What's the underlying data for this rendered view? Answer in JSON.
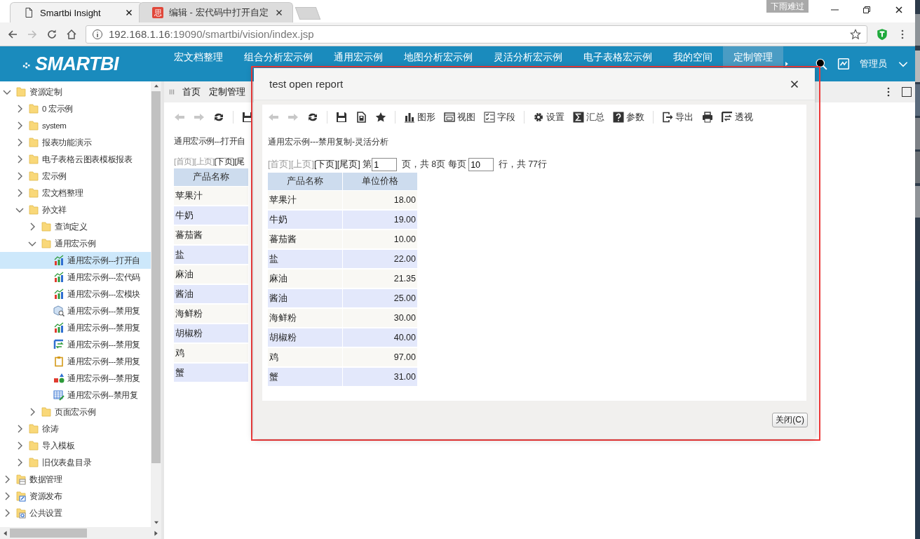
{
  "browser": {
    "tabs": [
      {
        "title": "Smartbi Insight",
        "selected": true
      },
      {
        "favicon_text": "思",
        "title": "编辑 - 宏代码中打开自定",
        "selected": false
      }
    ],
    "overlay_label": "下雨难过",
    "url_host": "192.168.1.16",
    "url_path": ":19090/smartbi/vision/index.jsp"
  },
  "header": {
    "logo": "SMARTBI",
    "nav": [
      {
        "label": "宏文档整理",
        "selected": false
      },
      {
        "label": "组合分析宏示例",
        "selected": false
      },
      {
        "label": "通用宏示例",
        "selected": false
      },
      {
        "label": "地图分析宏示例",
        "selected": false
      },
      {
        "label": "灵活分析宏示例",
        "selected": false
      },
      {
        "label": "电子表格宏示例",
        "selected": false
      },
      {
        "label": "我的空间",
        "selected": false
      },
      {
        "label": "定制管理",
        "selected": true
      }
    ],
    "user": "管理员"
  },
  "tree": [
    {
      "label": "资源定制",
      "kind": "folder",
      "expanded": true,
      "selected": false,
      "children": [
        {
          "label": "0 宏示例",
          "kind": "folder",
          "expanded": false,
          "selected": false
        },
        {
          "label": "system",
          "kind": "folder",
          "expanded": false,
          "selected": false
        },
        {
          "label": "报表功能演示",
          "kind": "folder",
          "expanded": false,
          "selected": false
        },
        {
          "label": "电子表格云图表模板报表",
          "kind": "folder",
          "expanded": false,
          "selected": false
        },
        {
          "label": "宏示例",
          "kind": "folder",
          "expanded": false,
          "selected": false
        },
        {
          "label": "宏文档整理",
          "kind": "folder",
          "expanded": false,
          "selected": false
        },
        {
          "label": "孙文祥",
          "kind": "folder",
          "expanded": true,
          "selected": false,
          "children": [
            {
              "label": "查询定义",
              "kind": "folder",
              "expanded": false,
              "selected": false
            },
            {
              "label": "通用宏示例",
              "kind": "folder",
              "expanded": true,
              "selected": false,
              "children": [
                {
                  "label": "通用宏示例---打开自",
                  "kind": "chart",
                  "selected": true
                },
                {
                  "label": "通用宏示例---宏代码",
                  "kind": "chart",
                  "selected": false
                },
                {
                  "label": "通用宏示例---宏模块",
                  "kind": "chart",
                  "selected": false
                },
                {
                  "label": "通用宏示例---禁用复",
                  "kind": "cube",
                  "selected": false
                },
                {
                  "label": "通用宏示例---禁用复",
                  "kind": "chart",
                  "selected": false
                },
                {
                  "label": "通用宏示例---禁用复",
                  "kind": "flow",
                  "selected": false
                },
                {
                  "label": "通用宏示例---禁用复",
                  "kind": "clipboard",
                  "selected": false
                },
                {
                  "label": "通用宏示例---禁用复",
                  "kind": "shapes",
                  "selected": false
                },
                {
                  "label": "通用宏示例--禁用复",
                  "kind": "grid",
                  "selected": false
                }
              ]
            },
            {
              "label": "页面宏示例",
              "kind": "folder",
              "expanded": false,
              "selected": false
            }
          ]
        },
        {
          "label": "徐涛",
          "kind": "folder",
          "expanded": false,
          "selected": false
        },
        {
          "label": "导入模板",
          "kind": "folder",
          "expanded": false,
          "selected": false
        },
        {
          "label": "旧仪表盘目录",
          "kind": "folder",
          "expanded": false,
          "selected": false
        }
      ]
    },
    {
      "label": "数据管理",
      "kind": "data",
      "expanded": false,
      "selected": false
    },
    {
      "label": "资源发布",
      "kind": "publish",
      "expanded": false,
      "selected": false
    },
    {
      "label": "公共设置",
      "kind": "settings",
      "expanded": false,
      "selected": false
    }
  ],
  "workspace": {
    "tabs": [
      "首页",
      "定制管理"
    ],
    "toolbar": [
      {
        "disabled": true
      },
      {
        "disabled": true
      },
      {
        "disabled": false
      },
      {
        "disabled": false
      }
    ],
    "report_title": "通用宏示例---打开自",
    "pager": [
      {
        "label": "[首页]",
        "disabled": true
      },
      {
        "label": "[上页]",
        "disabled": true
      },
      {
        "label": "[下页]",
        "disabled": false
      },
      {
        "label": "[尾",
        "disabled": false
      }
    ],
    "table": {
      "columns": [
        "产品名称"
      ],
      "rows": [
        [
          "苹果汁"
        ],
        [
          "牛奶"
        ],
        [
          "蕃茄酱"
        ],
        [
          "盐"
        ],
        [
          "麻油"
        ],
        [
          "酱油"
        ],
        [
          "海鲜粉"
        ],
        [
          "胡椒粉"
        ],
        [
          "鸡"
        ],
        [
          "蟹"
        ]
      ]
    }
  },
  "dialog": {
    "title": "test open report",
    "toolbar": [
      [
        {
          "disabled": true
        },
        {
          "disabled": true
        },
        {
          "disabled": false
        }
      ],
      [
        {
          "disabled": false
        },
        {
          "disabled": false
        },
        {
          "disabled": false
        }
      ],
      [
        {
          "label": "图形",
          "disabled": false
        },
        {
          "label": "视图",
          "disabled": false
        },
        {
          "label": "字段",
          "disabled": false
        }
      ],
      [
        {
          "label": "设置",
          "disabled": false
        },
        {
          "label": "汇总",
          "disabled": false
        },
        {
          "label": "参数",
          "disabled": false
        }
      ],
      [
        {
          "label": "导出",
          "disabled": false
        },
        {
          "disabled": false
        },
        {
          "label": "透视",
          "disabled": false
        }
      ]
    ],
    "report_title": "通用宏示例---禁用复制-灵活分析",
    "pager": {
      "links": [
        {
          "label": "[首页]",
          "disabled": true
        },
        {
          "label": "[上页]",
          "disabled": true
        },
        {
          "label": "[下页]",
          "disabled": false
        },
        {
          "label": "[尾页]",
          "disabled": false
        }
      ],
      "page_prefix": "第",
      "page": "1",
      "page_info": "页，共 8页 每页",
      "page_size": "10",
      "rows_info": "行，共 77行"
    },
    "table": {
      "columns": [
        "产品名称",
        "单位价格"
      ],
      "rows": [
        [
          "苹果汁",
          "18.00"
        ],
        [
          "牛奶",
          "19.00"
        ],
        [
          "蕃茄酱",
          "10.00"
        ],
        [
          "盐",
          "22.00"
        ],
        [
          "麻油",
          "21.35"
        ],
        [
          "酱油",
          "25.00"
        ],
        [
          "海鲜粉",
          "30.00"
        ],
        [
          "胡椒粉",
          "40.00"
        ],
        [
          "鸡",
          "97.00"
        ],
        [
          "蟹",
          "31.00"
        ]
      ]
    },
    "close_button": "关闭(C)"
  }
}
